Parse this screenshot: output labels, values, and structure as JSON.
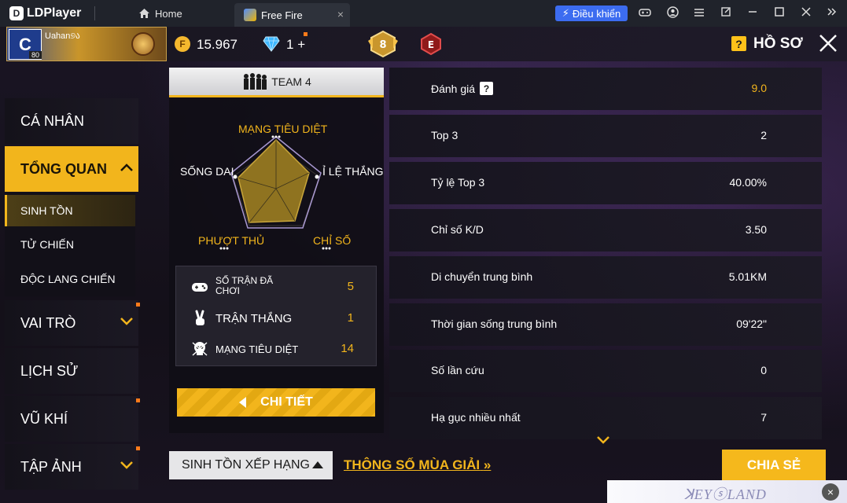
{
  "emulator": {
    "app_name": "LDPlayer",
    "logo_letter": "D",
    "home_tab": "Home",
    "game_tab": "Free Fire",
    "control_button": "Điều khiển",
    "tab_close": "×"
  },
  "header": {
    "username": "Uahan୭ა",
    "avatar_letter": "C",
    "level": "80",
    "coin_symbol": "F",
    "coins": "15.967",
    "diamonds": "1",
    "diamond_plus": "+",
    "rank_number": "8",
    "rank_letter": "E",
    "help_symbol": "?",
    "title": "HỒ SƠ"
  },
  "sidebar": {
    "items": [
      {
        "label": "CÁ NHÂN"
      },
      {
        "label": "TỔNG QUAN"
      },
      {
        "label": "VAI TRÒ"
      },
      {
        "label": "LỊCH SỬ"
      },
      {
        "label": "VŨ KHÍ"
      },
      {
        "label": "TẬP ẢNH"
      }
    ],
    "sub_items": [
      {
        "label": "SINH TỒN"
      },
      {
        "label": "TỬ CHIẾN"
      },
      {
        "label": "ĐỘC LANG CHIẾN"
      }
    ]
  },
  "team": {
    "header": "TEAM 4",
    "radar": {
      "top": "MẠNG TIÊU DIỆT",
      "right": "Ỉ LỆ THẮNG",
      "left": "SỐNG DAI",
      "bottom_left": "PHƯỢT THỦ",
      "bottom_right": "CHỈ SỐ"
    },
    "stats": [
      {
        "label": "SỐ TRẬN ĐÃ CHƠI",
        "value": "5"
      },
      {
        "label": "TRẬN THẮNG",
        "value": "1"
      },
      {
        "label": "MẠNG TIÊU DIỆT",
        "value": "14"
      }
    ],
    "detail_button": "CHI TIẾT"
  },
  "stats_list": [
    {
      "label": "Đánh giá",
      "value": "9.0",
      "help": "?"
    },
    {
      "label": "Top 3",
      "value": "2"
    },
    {
      "label": "Tỷ lệ Top 3",
      "value": "40.00%"
    },
    {
      "label": "Chỉ số K/D",
      "value": "3.50"
    },
    {
      "label": "Di chuyển trung bình",
      "value": "5.01KM"
    },
    {
      "label": "Thời gian sống trung bình",
      "value": "09'22\""
    },
    {
      "label": "Số lần cứu",
      "value": "0"
    },
    {
      "label": "Hạ gục nhiều nhất",
      "value": "7"
    }
  ],
  "bottom": {
    "mode_select": "SINH TỒN XẾP HẠNG",
    "season_link": "THÔNG SỐ MÙA GIẢI",
    "season_arrows": "»",
    "share_button": "CHIA SẺ"
  },
  "watermark": {
    "text": "ꓘEYⓢLAND",
    "close": "×"
  },
  "colors": {
    "accent": "#f2b51c",
    "control_blue": "#3c6cf0",
    "panel_bg": "#16141e"
  }
}
